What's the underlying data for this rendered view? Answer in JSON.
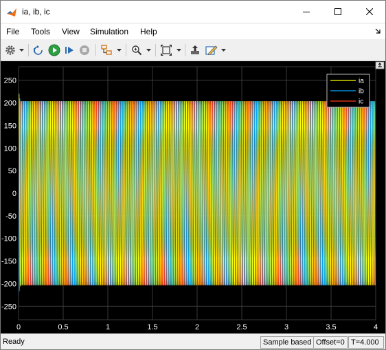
{
  "window": {
    "title": "ia, ib, ic"
  },
  "menu": [
    "File",
    "Tools",
    "View",
    "Simulation",
    "Help"
  ],
  "toolbar": {
    "icons": [
      "settings-icon",
      "step-back-icon",
      "run-icon",
      "step-forward-icon",
      "stop-icon",
      "signal-select-icon",
      "zoom-icon",
      "autoscale-icon",
      "restore-icon",
      "style-icon"
    ]
  },
  "status": {
    "ready": "Ready",
    "mode": "Sample based",
    "offset": "Offset=0",
    "time": "T=4.000"
  },
  "colors": {
    "ia": "#ffff00",
    "ib": "#00a8ff",
    "ic": "#ff3b1f",
    "plot_bg": "#000000",
    "grid": "#505050",
    "axes_frame": "#1a1a1a"
  },
  "chart_data": {
    "type": "line",
    "xlim": [
      0,
      4
    ],
    "ylim": [
      -280,
      280
    ],
    "x_ticks": [
      "0",
      "0.5",
      "1",
      "1.5",
      "2",
      "2.5",
      "3",
      "3.5",
      "4"
    ],
    "y_ticks": [
      "250",
      "200",
      "150",
      "100",
      "50",
      "0",
      "-50",
      "-100",
      "-150",
      "-200",
      "-250"
    ],
    "grid": true,
    "legend_position": "top-right",
    "series": [
      {
        "name": "ia",
        "amplitude": 205,
        "frequency_hz": 40,
        "phase_deg": 0
      },
      {
        "name": "ib",
        "amplitude": 205,
        "frequency_hz": 40,
        "phase_deg": -120
      },
      {
        "name": "ic",
        "amplitude": 205,
        "frequency_hz": 40,
        "phase_deg": 120
      }
    ]
  }
}
